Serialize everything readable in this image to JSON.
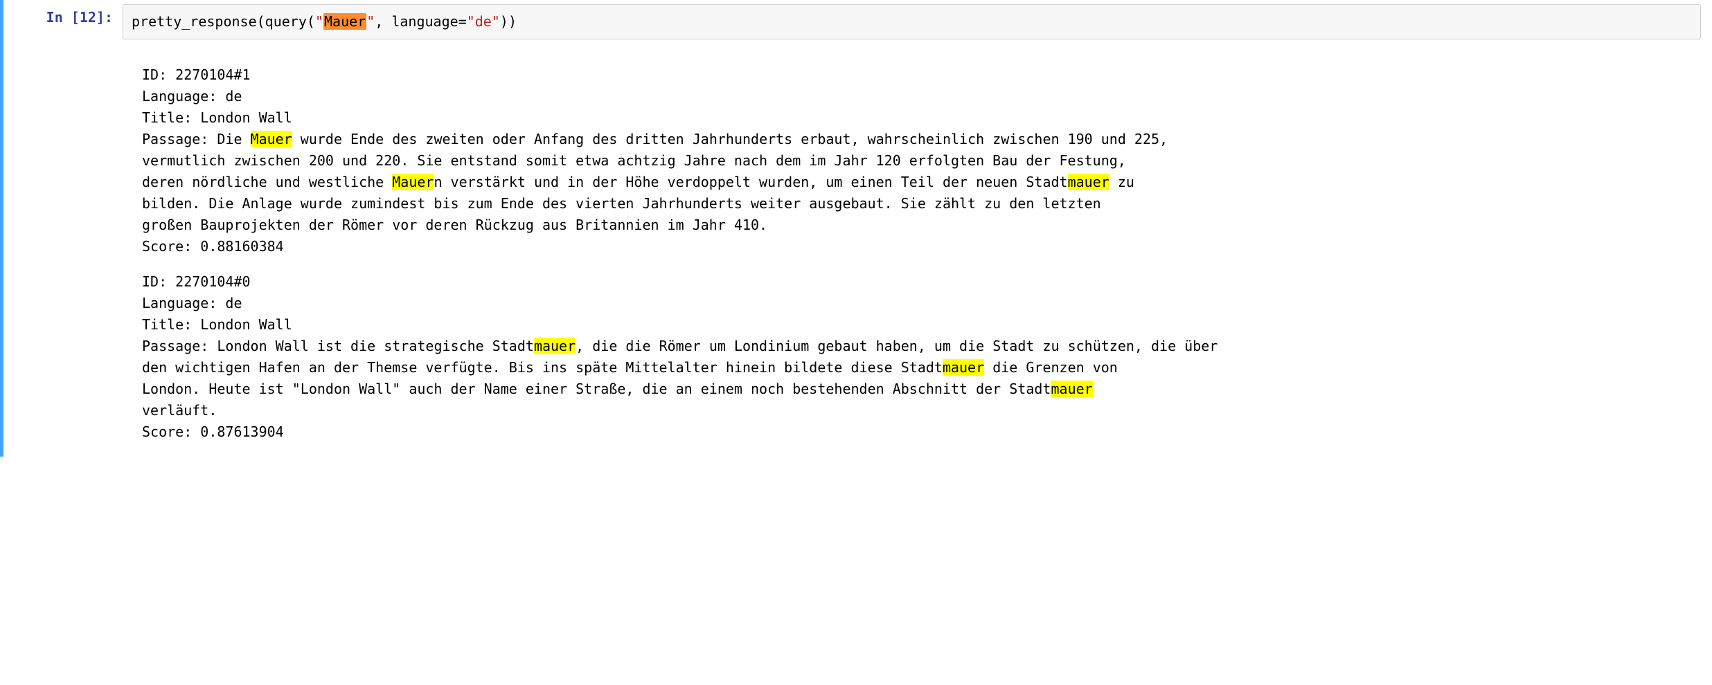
{
  "prompt": {
    "label": "In [12]:"
  },
  "code": {
    "func1": "pretty_response",
    "open1": "(",
    "func2": "query",
    "open2": "(",
    "quote_open1": "\"",
    "search_term": "Mauer",
    "quote_close1": "\"",
    "comma": ", ",
    "kwarg": "language",
    "eq": "=",
    "quote_open2": "\"",
    "lang_value": "de",
    "quote_close2": "\"",
    "close2": ")",
    "close1": ")"
  },
  "labels": {
    "id": "ID: ",
    "language": "Language: ",
    "title": "Title: ",
    "passage": "Passage: ",
    "score": "Score: "
  },
  "results": [
    {
      "id": "2270104#1",
      "language": "de",
      "title": "London Wall",
      "passage_segments": [
        {
          "text": "Die ",
          "hl": false
        },
        {
          "text": "Mauer",
          "hl": true
        },
        {
          "text": " wurde Ende des zweiten oder Anfang des dritten Jahrhunderts erbaut, wahrscheinlich zwischen 190 und 225,\nvermutlich zwischen 200 und 220. Sie entstand somit etwa achtzig Jahre nach dem im Jahr 120 erfolgten Bau der Festung,\nderen nördliche und westliche ",
          "hl": false
        },
        {
          "text": "Mauer",
          "hl": true
        },
        {
          "text": "n verstärkt und in der Höhe verdoppelt wurden, um einen Teil der neuen Stadt",
          "hl": false
        },
        {
          "text": "mauer",
          "hl": true
        },
        {
          "text": " zu\nbilden. Die Anlage wurde zumindest bis zum Ende des vierten Jahrhunderts weiter ausgebaut. Sie zählt zu den letzten\ngroßen Bauprojekten der Römer vor deren Rückzug aus Britannien im Jahr 410.",
          "hl": false
        }
      ],
      "score": "0.88160384"
    },
    {
      "id": "2270104#0",
      "language": "de",
      "title": "London Wall",
      "passage_segments": [
        {
          "text": "London Wall ist die strategische Stadt",
          "hl": false
        },
        {
          "text": "mauer",
          "hl": true
        },
        {
          "text": ", die die Römer um Londinium gebaut haben, um die Stadt zu schützen, die über\nden wichtigen Hafen an der Themse verfügte. Bis ins späte Mittelalter hinein bildete diese Stadt",
          "hl": false
        },
        {
          "text": "mauer",
          "hl": true
        },
        {
          "text": " die Grenzen von\nLondon. Heute ist \"London Wall\" auch der Name einer Straße, die an einem noch bestehenden Abschnitt der Stadt",
          "hl": false
        },
        {
          "text": "mauer",
          "hl": true
        },
        {
          "text": "\nverläuft.",
          "hl": false
        }
      ],
      "score": "0.87613904"
    }
  ]
}
